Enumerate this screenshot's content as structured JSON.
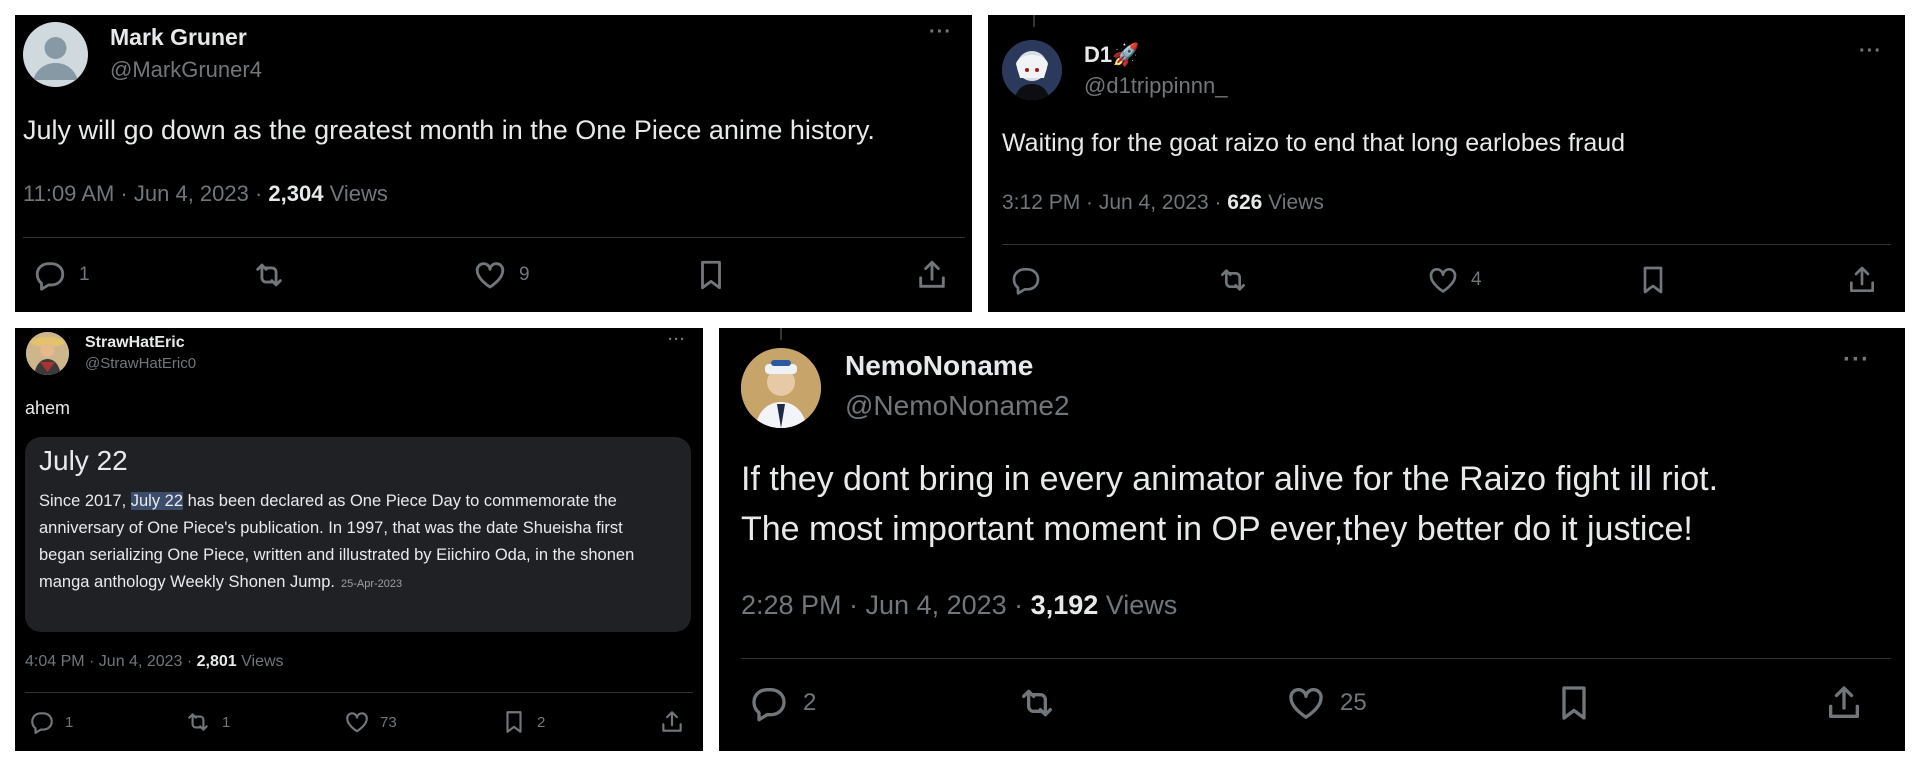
{
  "tweets": [
    {
      "name": "Mark Gruner",
      "handle": "@MarkGruner4",
      "text": "July will go down as the greatest month in the One Piece anime history.",
      "time": "11:09 AM · Jun 4, 2023 · ",
      "views_count": "2,304",
      "views_label": " Views",
      "replies": "1",
      "retweets": "",
      "likes": "9",
      "bookmarks": "",
      "more": "···"
    },
    {
      "name": "D1🚀",
      "handle": "@d1trippinnn_",
      "text": "Waiting for the goat raizo to end that long earlobes fraud",
      "time": "3:12 PM · Jun 4, 2023 · ",
      "views_count": "626",
      "views_label": " Views",
      "replies": "",
      "retweets": "",
      "likes": "4",
      "bookmarks": "",
      "more": "···"
    },
    {
      "name": "StrawHatEric",
      "handle": "@StrawHatEric0",
      "text": "ahem",
      "card": {
        "title": "July 22",
        "text_before": "Since 2017, ",
        "highlight": "July 22",
        "text_after": " has been declared as One Piece Day to commemorate the anniversary of One Piece's publication. In 1997, that was the date Shueisha first began serializing One Piece, written and illustrated by Eiichiro Oda, in the shonen manga anthology Weekly Shonen Jump.",
        "date": "25-Apr-2023"
      },
      "time": "4:04 PM · Jun 4, 2023 · ",
      "views_count": "2,801",
      "views_label": " Views",
      "replies": "1",
      "retweets": "1",
      "likes": "73",
      "bookmarks": "2",
      "more": "···"
    },
    {
      "name": "NemoNoname",
      "handle": "@NemoNoname2",
      "text_line1": "If they dont bring in every animator alive for the Raizo fight ill riot.",
      "text_line2": "The most important moment in OP ever,they better do it justice!",
      "time": "2:28 PM · Jun 4, 2023 · ",
      "views_count": "3,192",
      "views_label": " Views",
      "replies": "2",
      "retweets": "",
      "likes": "25",
      "bookmarks": "",
      "more": "···"
    }
  ],
  "colors": {
    "background": "#000000",
    "text_primary": "#e7e9ea",
    "text_secondary": "#71767b",
    "divider": "#2f3336",
    "card_bg": "#202124"
  },
  "icons": [
    "reply-icon",
    "retweet-icon",
    "like-icon",
    "bookmark-icon",
    "share-icon",
    "more-icon"
  ]
}
